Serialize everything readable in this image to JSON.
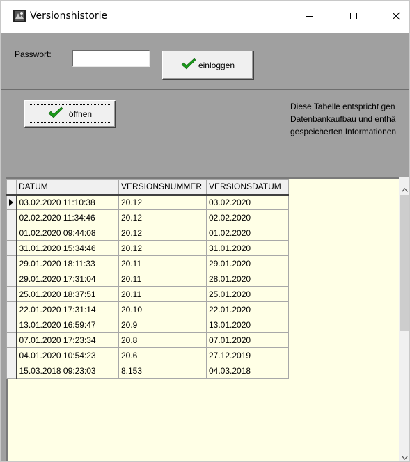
{
  "window": {
    "title": "Versionshistorie",
    "icon": "app-icon"
  },
  "login": {
    "password_label": "Passwort:",
    "password_value": "",
    "login_button": "einloggen"
  },
  "actions": {
    "open_button": "öffnen"
  },
  "info": {
    "lines": [
      "Diese Tabelle entspricht gen",
      "Datenbankaufbau und enthä",
      "gespeicherten Informationen"
    ]
  },
  "table": {
    "columns": [
      "DATUM",
      "VERSIONSNUMMER",
      "VERSIONSDATUM"
    ],
    "current_row": 0,
    "rows": [
      [
        "03.02.2020 11:10:38",
        "20.12",
        "03.02.2020"
      ],
      [
        "02.02.2020 11:34:46",
        "20.12",
        "02.02.2020"
      ],
      [
        "01.02.2020 09:44:08",
        "20.12",
        "01.02.2020"
      ],
      [
        "31.01.2020 15:34:46",
        "20.12",
        "31.01.2020"
      ],
      [
        "29.01.2020 18:11:33",
        "20.11",
        "29.01.2020"
      ],
      [
        "29.01.2020 17:31:04",
        "20.11",
        "28.01.2020"
      ],
      [
        "25.01.2020 18:37:51",
        "20.11",
        "25.01.2020"
      ],
      [
        "22.01.2020 17:31:14",
        "20.10",
        "22.01.2020"
      ],
      [
        "13.01.2020 16:59:47",
        "20.9",
        "13.01.2020"
      ],
      [
        "07.01.2020 17:23:34",
        "20.8",
        "07.01.2020"
      ],
      [
        "04.01.2020 10:54:23",
        "20.6",
        "27.12.2019"
      ],
      [
        "15.03.2018 09:23:03",
        "8.153",
        "04.03.2018"
      ]
    ]
  },
  "colors": {
    "panel": "#a0a0a0",
    "grid_background": "#ffffe6",
    "check_green": "#1a9a1a"
  }
}
